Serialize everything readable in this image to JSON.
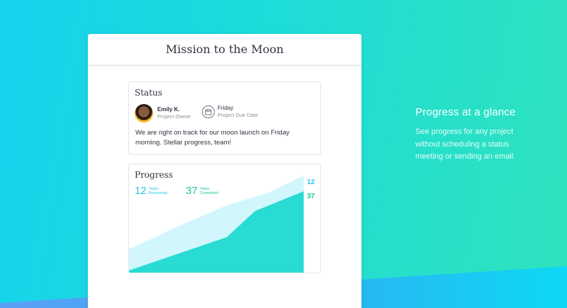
{
  "panel": {
    "title": "Mission to the Moon"
  },
  "status": {
    "heading": "Status",
    "owner": {
      "name": "Emily K.",
      "role": "Project Owner"
    },
    "due": {
      "day": "Friday",
      "label": "Project Due Date"
    },
    "message": "We are right on track for our moon launch on Friday morning. Stellar progress, team!"
  },
  "progress": {
    "heading": "Progress",
    "remaining": {
      "value": "12",
      "label_1": "Tasks",
      "label_2": "Remaining"
    },
    "completed": {
      "value": "37",
      "label_1": "Tasks",
      "label_2": "Completed"
    },
    "end_remaining": "12",
    "end_completed": "37"
  },
  "promo": {
    "title": "Progress at a glance",
    "body": "See progress for any project without scheduling a status meeting or sending an email."
  },
  "colors": {
    "remaining": "#2fc6e6",
    "completed": "#27c49f",
    "background_start": "#16d2ee",
    "background_end": "#2fe3bd"
  },
  "icons": {
    "owner_avatar": "avatar",
    "due_date": "calendar-icon"
  }
}
